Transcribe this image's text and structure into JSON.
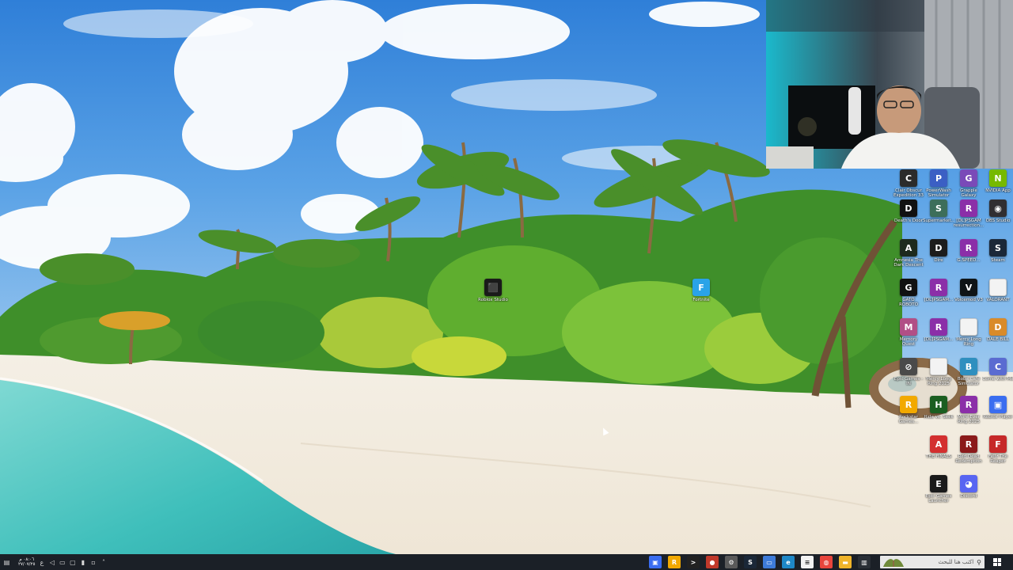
{
  "desktop": {
    "center_icons": [
      {
        "label": "Roblox Studio",
        "icon": "roblox-studio-icon",
        "color": "#1a1a1a",
        "glyph": "⬛"
      },
      {
        "label": "Fortnite",
        "icon": "fortnite-icon",
        "color": "#2aa3e8",
        "glyph": "F"
      }
    ],
    "icons": [
      {
        "label": "Clair Obscur Expedition 33",
        "icon": "clair-obscur-icon",
        "color": "#2b2b2b",
        "glyph": "C"
      },
      {
        "label": "PowerWash Simulator",
        "icon": "powerwash-icon",
        "color": "#3b5fc4",
        "glyph": "P"
      },
      {
        "label": "Grapple Galaxy",
        "icon": "grapple-galaxy-icon",
        "color": "#7a4ab8",
        "glyph": "G"
      },
      {
        "label": "NVIDIA App",
        "icon": "nvidia-icon",
        "color": "#76b900",
        "glyph": "N"
      },
      {
        "label": "Death's Door",
        "icon": "deaths-door-icon",
        "color": "#111111",
        "glyph": "D"
      },
      {
        "label": "Supermarket...",
        "icon": "supermarket-icon",
        "color": "#3d6e5a",
        "glyph": "S"
      },
      {
        "label": "[DL]PSGAM resurrection...",
        "icon": "winrar-icon",
        "color": "#8b2fa8",
        "glyph": "R"
      },
      {
        "label": "OBS Studio",
        "icon": "obs-icon",
        "color": "#302e31",
        "glyph": "◉"
      },
      {
        "label": "Amnesia The Dark Descent",
        "icon": "amnesia-icon",
        "color": "#1d2a1d",
        "glyph": "A"
      },
      {
        "label": "Dire",
        "icon": "dire-icon",
        "color": "#1c1c1c",
        "glyph": "D"
      },
      {
        "label": "G.SPEED...",
        "icon": "winrar-icon",
        "color": "#8b2fa8",
        "glyph": "R"
      },
      {
        "label": "Steam",
        "icon": "steam-icon",
        "color": "#1b2838",
        "glyph": "S"
      },
      {
        "label": "GATO ROBOTO",
        "icon": "gato-roboto-icon",
        "color": "#111111",
        "glyph": "G"
      },
      {
        "label": "[DL]PSGAM...",
        "icon": "winrar-icon",
        "color": "#8b2fa8",
        "glyph": "R"
      },
      {
        "label": "Voicemod V3",
        "icon": "voicemod-icon",
        "color": "#0f1416",
        "glyph": "V"
      },
      {
        "label": "VALORANT",
        "icon": "file-icon",
        "color": "#f3f3f3",
        "glyph": ""
      },
      {
        "label": "Memory Quest",
        "icon": "memory-quest-icon",
        "color": "#b14f86",
        "glyph": "M"
      },
      {
        "label": "[DL]PSGAM...",
        "icon": "winrar-icon",
        "color": "#8b2fa8",
        "glyph": "R"
      },
      {
        "label": "Mercy Long Ring",
        "icon": "file-icon",
        "color": "#f3f3f3",
        "glyph": ""
      },
      {
        "label": "DALE BILL",
        "icon": "dale-bill-icon",
        "color": "#d98b2a",
        "glyph": "D"
      },
      {
        "label": "Epic Games - IN",
        "icon": "epic-shortcut-icon",
        "color": "#4a4a4a",
        "glyph": "⊘"
      },
      {
        "label": "Mercy Long Ring 2025",
        "icon": "file-icon",
        "color": "#f3f3f3",
        "glyph": ""
      },
      {
        "label": "Boba Cafe Simulator",
        "icon": "boba-cafe-icon",
        "color": "#2f8fbf",
        "glyph": "B"
      },
      {
        "label": "Come with Me",
        "icon": "come-with-me-icon",
        "color": "#5a6bd1",
        "glyph": "C"
      },
      {
        "label": "Rockstar Games...",
        "icon": "rockstar-icon",
        "color": "#f2a900",
        "glyph": "R"
      },
      {
        "label": "Hide vs. Seek",
        "icon": "hide-vs-seek-icon",
        "color": "#1b5e20",
        "glyph": "H"
      },
      {
        "label": "More Ever Ring 2025",
        "icon": "winrar-icon",
        "color": "#8b2fa8",
        "glyph": "R"
      },
      {
        "label": "Roblox Player",
        "icon": "roblox-player-icon",
        "color": "#3a6df0",
        "glyph": "▣"
      },
      {
        "label": "THE FINALS",
        "icon": "the-finals-icon",
        "color": "#d32f2f",
        "glyph": "A"
      },
      {
        "label": "Red Dead Redemption",
        "icon": "red-dead-icon",
        "color": "#8b1a1a",
        "glyph": "R"
      },
      {
        "label": "Fellz The Reaper",
        "icon": "fellz-icon",
        "color": "#c62828",
        "glyph": "F"
      },
      {
        "label": "Epic Games Launcher",
        "icon": "epic-games-icon",
        "color": "#1a1a1a",
        "glyph": "E"
      },
      {
        "label": "Discord",
        "icon": "discord-icon",
        "color": "#5865f2",
        "glyph": "◕"
      }
    ]
  },
  "taskbar": {
    "clock_time": "٠٨:٠٦ م",
    "clock_date": "٢٧/٠٧/٢٥",
    "search_placeholder": "اكتب هنا للبحث",
    "tray_icons": [
      "keyboard-icon",
      "volume-icon",
      "network-icon",
      "display-icon",
      "mic-icon",
      "battery-icon",
      "chevron-up-icon"
    ],
    "pinned_apps": [
      {
        "name": "roblox-taskbar-icon",
        "color": "#3a6df0",
        "glyph": "▣"
      },
      {
        "name": "rockstar-taskbar-icon",
        "color": "#f2a900",
        "glyph": "R"
      },
      {
        "name": "terminal-taskbar-icon",
        "color": "#222222",
        "glyph": ">"
      },
      {
        "name": "recorder-taskbar-icon",
        "color": "#c0392b",
        "glyph": "●"
      },
      {
        "name": "settings-taskbar-icon",
        "color": "#5a5a5a",
        "glyph": "⚙"
      },
      {
        "name": "steam-taskbar-icon",
        "color": "#1b2838",
        "glyph": "S"
      },
      {
        "name": "remote-taskbar-icon",
        "color": "#3d7bd9",
        "glyph": "▭"
      },
      {
        "name": "edge-taskbar-icon",
        "color": "#1e88c7",
        "glyph": "e"
      },
      {
        "name": "notepad-taskbar-icon",
        "color": "#f2f2f2",
        "glyph": "≡"
      },
      {
        "name": "chrome-taskbar-icon",
        "color": "#e8453c",
        "glyph": "◍"
      },
      {
        "name": "file-explorer-taskbar-icon",
        "color": "#f0b429",
        "glyph": "▬"
      },
      {
        "name": "task-view-taskbar-icon",
        "color": "#2a2f36",
        "glyph": "▥"
      }
    ]
  }
}
